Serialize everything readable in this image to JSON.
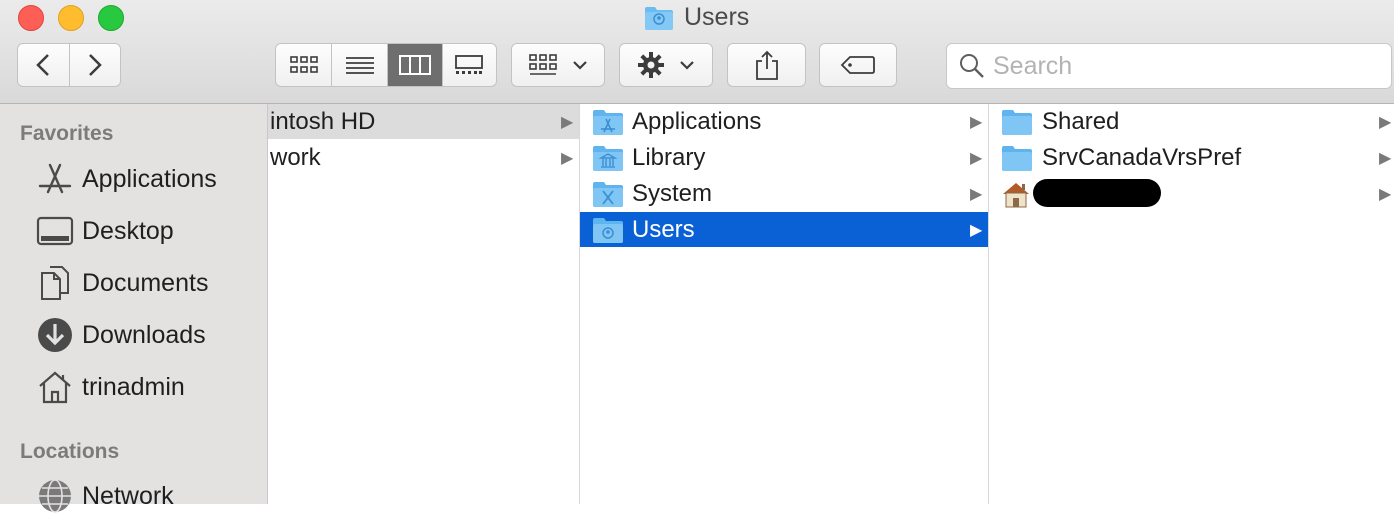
{
  "window": {
    "title": "Users"
  },
  "search": {
    "placeholder": "Search"
  },
  "sidebar": {
    "favorites_label": "Favorites",
    "favorites": [
      {
        "label": "Applications",
        "icon": "applications-icon"
      },
      {
        "label": "Desktop",
        "icon": "desktop-icon"
      },
      {
        "label": "Documents",
        "icon": "documents-icon"
      },
      {
        "label": "Downloads",
        "icon": "downloads-icon"
      },
      {
        "label": "trinadmin",
        "icon": "home-icon"
      }
    ],
    "locations_label": "Locations",
    "locations": [
      {
        "label": "Network",
        "icon": "network-icon"
      }
    ]
  },
  "columns": {
    "col1": [
      {
        "label": "intosh HD",
        "selected": "inactive"
      },
      {
        "label": "work",
        "selected": "none"
      }
    ],
    "col2": [
      {
        "label": "Applications",
        "icon": "applications-folder-icon"
      },
      {
        "label": "Library",
        "icon": "library-folder-icon"
      },
      {
        "label": "System",
        "icon": "system-folder-icon"
      },
      {
        "label": "Users",
        "icon": "users-folder-icon",
        "selected": "active"
      }
    ],
    "col3": [
      {
        "label": "Shared",
        "icon": "folder-icon"
      },
      {
        "label": "SrvCanadaVrsPref",
        "icon": "folder-icon"
      },
      {
        "label": "",
        "icon": "home-icon",
        "redacted": true
      }
    ]
  },
  "colors": {
    "selection": "#0a61d6",
    "folder": "#5fb8f2"
  }
}
